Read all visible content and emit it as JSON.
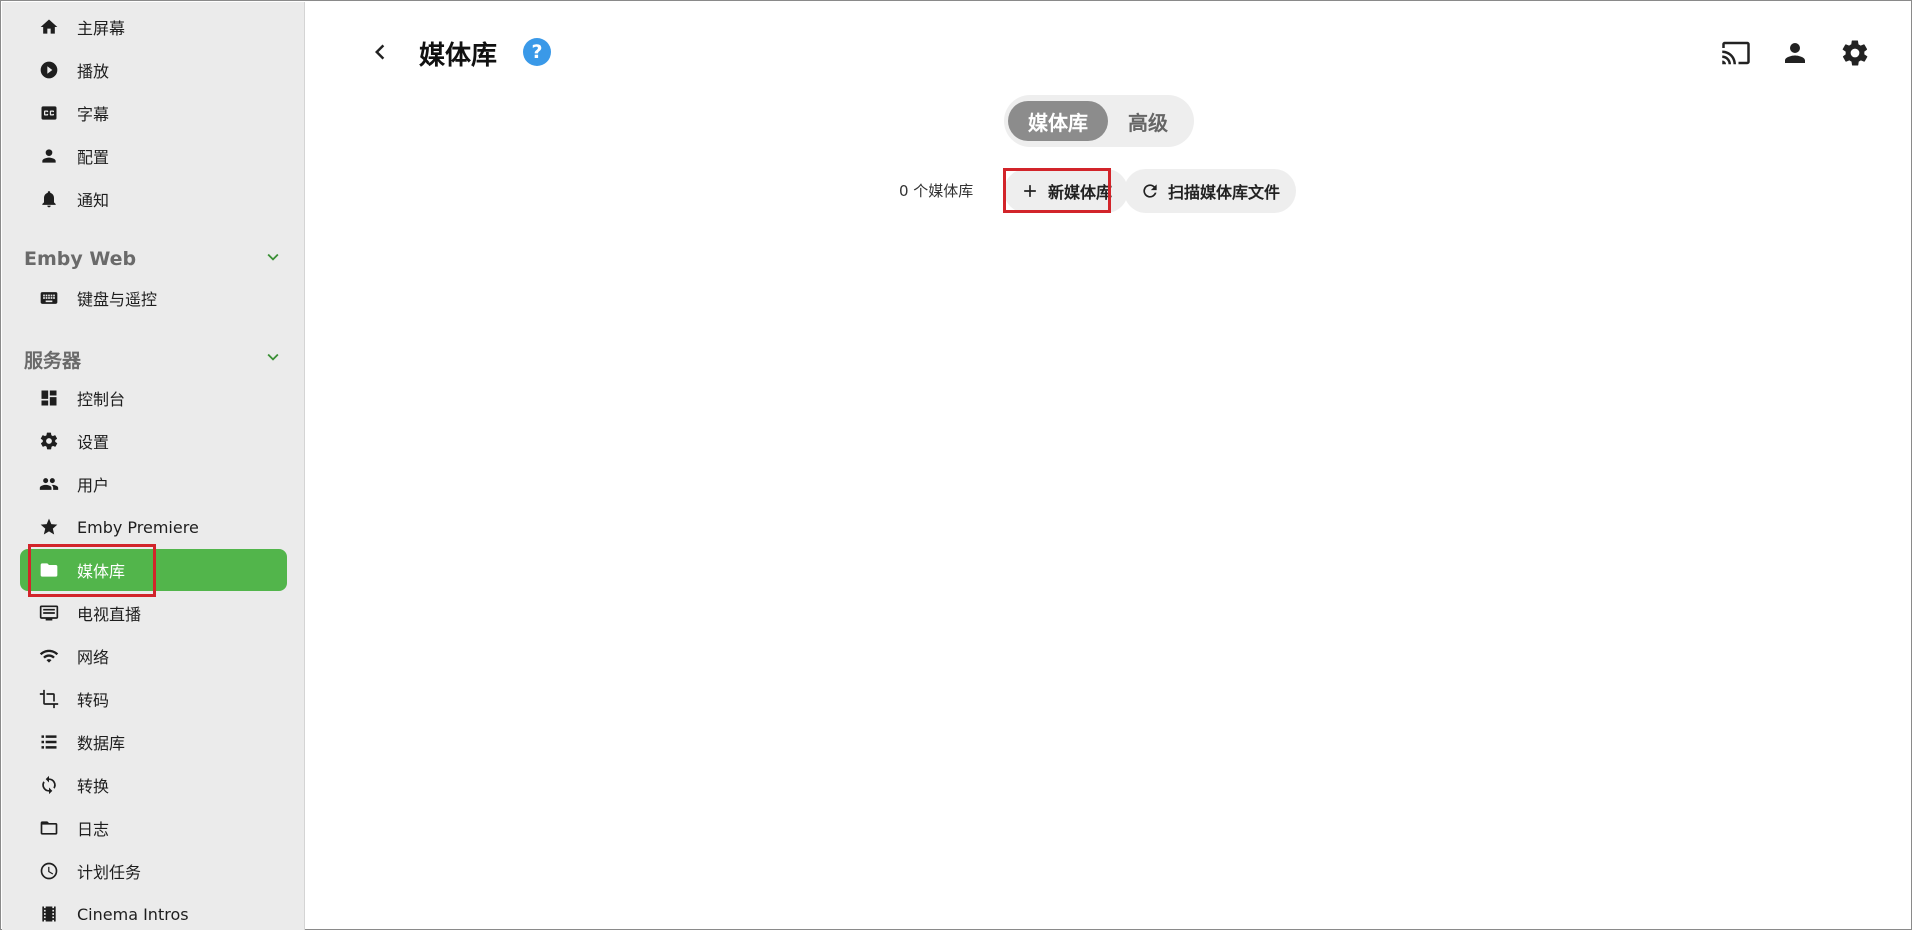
{
  "sidebar": {
    "top_items": [
      {
        "label": "主屏幕",
        "icon": "home-icon"
      },
      {
        "label": "播放",
        "icon": "play-circle-icon"
      },
      {
        "label": "字幕",
        "icon": "subtitles-icon"
      },
      {
        "label": "配置",
        "icon": "person-icon"
      },
      {
        "label": "通知",
        "icon": "bell-icon"
      }
    ],
    "sections": [
      {
        "title": "Emby Web",
        "items": [
          {
            "label": "键盘与遥控",
            "icon": "keyboard-icon"
          }
        ]
      },
      {
        "title": "服务器",
        "items": [
          {
            "label": "控制台",
            "icon": "dashboard-icon"
          },
          {
            "label": "设置",
            "icon": "gear-icon"
          },
          {
            "label": "用户",
            "icon": "people-icon"
          },
          {
            "label": "Emby Premiere",
            "icon": "star-icon"
          },
          {
            "label": "媒体库",
            "icon": "folder-icon",
            "active": true
          },
          {
            "label": "电视直播",
            "icon": "tv-icon"
          },
          {
            "label": "网络",
            "icon": "wifi-icon"
          },
          {
            "label": "转码",
            "icon": "crop-icon"
          },
          {
            "label": "数据库",
            "icon": "database-icon"
          },
          {
            "label": "转换",
            "icon": "sync-icon"
          },
          {
            "label": "日志",
            "icon": "folder-outline-icon"
          },
          {
            "label": "计划任务",
            "icon": "clock-icon"
          },
          {
            "label": "Cinema Intros",
            "icon": "film-icon"
          }
        ]
      }
    ]
  },
  "header": {
    "title": "媒体库",
    "help_label": "?"
  },
  "tabs": [
    {
      "label": "媒体库",
      "active": true
    },
    {
      "label": "高级",
      "active": false
    }
  ],
  "toolbar": {
    "count_label": "0 个媒体库",
    "new_library_label": "新媒体库",
    "scan_label": "扫描媒体库文件"
  },
  "colors": {
    "accent": "#52b54b",
    "highlight_box": "#d2242a",
    "help": "#3a99e8"
  }
}
